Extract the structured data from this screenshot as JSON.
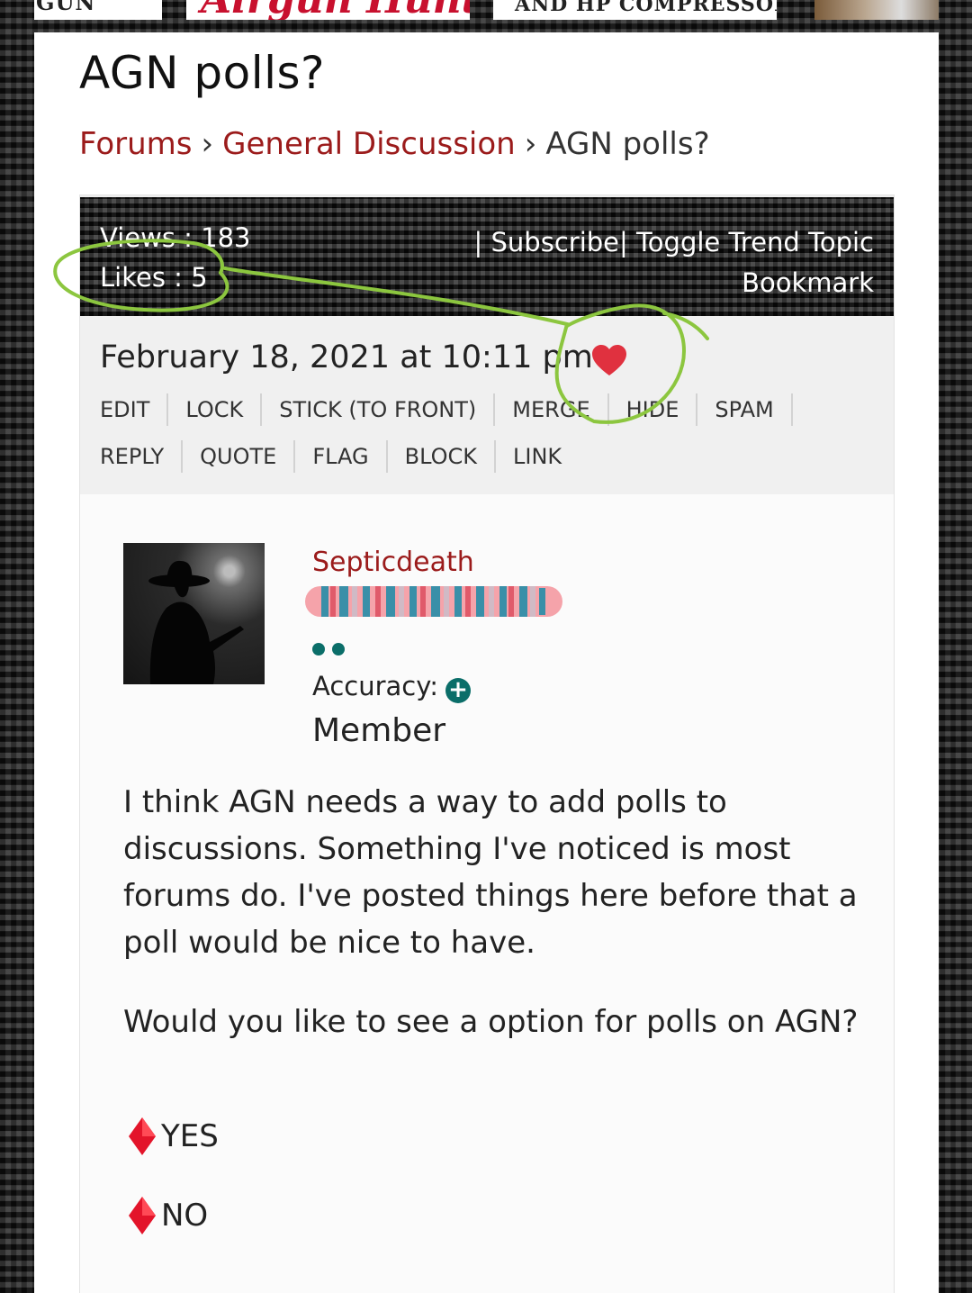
{
  "banners": {
    "banner1_text": "GUN",
    "banner2_text": "Airgun Hunter",
    "banner3_text": "AND HP COMPRESSOR"
  },
  "page_title": "AGN polls?",
  "breadcrumb": {
    "forums": "Forums",
    "separator": "›",
    "category": "General Discussion",
    "current": "AGN polls?"
  },
  "topic_stats": {
    "views": "Views : 183",
    "likes": "Likes : 5"
  },
  "topic_actions": {
    "subscribe": "| Subscribe|",
    "toggle_trend": "Toggle Trend Topic",
    "bookmark": "Bookmark"
  },
  "post": {
    "date": "February 18, 2021 at 10:11 pm",
    "actions_row1": [
      "EDIT",
      "LOCK",
      "STICK (TO FRONT)",
      "MERGE",
      "HIDE",
      "SPAM"
    ],
    "actions_row2": [
      "REPLY",
      "QUOTE",
      "FLAG",
      "BLOCK",
      "LINK"
    ],
    "author": "Septicdeath",
    "accuracy_label": "Accuracy:",
    "role": "Member",
    "paragraph1": "I think AGN needs a way to add polls to discussions. Something I've noticed is most forums do. I've posted things here before that a poll would be nice to have.",
    "paragraph2": "Would you like to see a option for polls on AGN?",
    "option_yes": "YES",
    "option_no": "NO"
  },
  "colors": {
    "link_red": "#9b1b1b",
    "heart_red": "#e0313f",
    "teal": "#0b6e69",
    "annotation_green": "#8cc63f"
  }
}
